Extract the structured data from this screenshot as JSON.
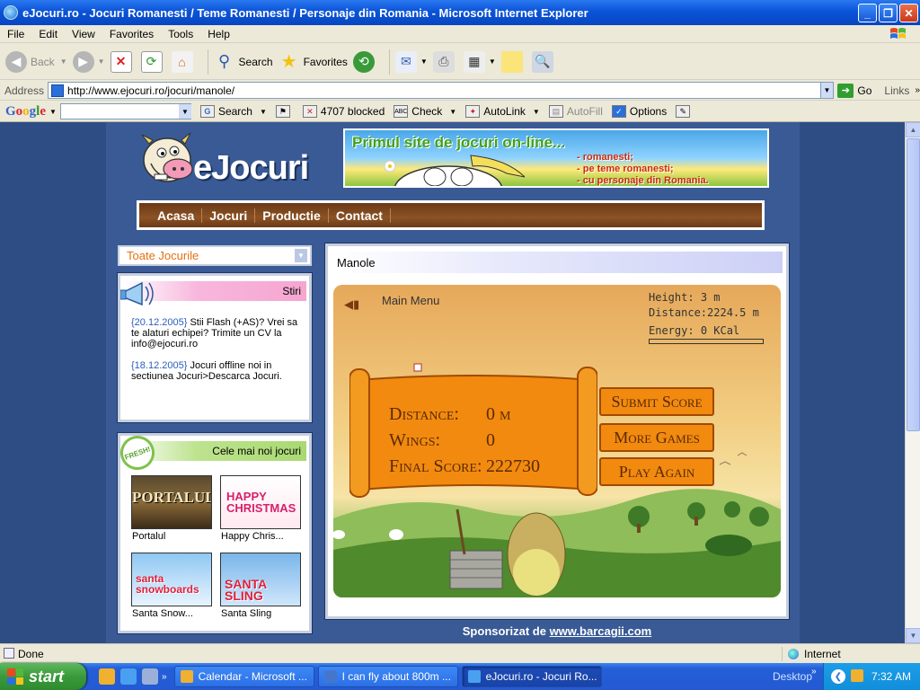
{
  "window": {
    "title": "eJocuri.ro - Jocuri Romanesti / Teme Romanesti / Personaje din Romania - Microsoft Internet Explorer"
  },
  "menu": [
    "File",
    "Edit",
    "View",
    "Favorites",
    "Tools",
    "Help"
  ],
  "toolbar": {
    "back": "Back",
    "search": "Search",
    "favorites": "Favorites"
  },
  "address": {
    "label": "Address",
    "url": "http://www.ejocuri.ro/jocuri/manole/",
    "go": "Go",
    "links": "Links"
  },
  "googlebar": {
    "logo": "Google",
    "search": "Search",
    "blocked": "4707 blocked",
    "check": "Check",
    "autolink": "AutoLink",
    "autofill": "AutoFill",
    "options": "Options"
  },
  "site": {
    "logo": "eJocuri",
    "banner": {
      "title": "Primul site de jocuri on-line...",
      "lines": [
        "- romanesti;",
        "- pe teme romanesti;",
        "- cu personaje din Romania."
      ]
    },
    "nav": [
      "Acasa",
      "Jocuri",
      "Productie",
      "Contact"
    ],
    "dropdown": "Toate Jocurile",
    "stiri": {
      "heading": "Stiri",
      "items": [
        {
          "date": "{20.12.2005}",
          "text": " Stii Flash (+AS)? Vrei sa te alaturi echipei? Trimite un CV la info@ejocuri.ro"
        },
        {
          "date": "{18.12.2005}",
          "text": " Jocuri offline noi in sectiunea Jocuri>Descarca Jocuri."
        }
      ]
    },
    "noi": {
      "heading": "Cele mai noi jocuri",
      "badge": "FRESH!",
      "games": [
        {
          "label": "Portalul",
          "art": "PORTALUL"
        },
        {
          "label": "Happy Chris...",
          "art": "HAPPY CHRISTMAS"
        },
        {
          "label": "Santa Snow...",
          "art": "santa snowboards"
        },
        {
          "label": "Santa Sling",
          "art": "SANTA SLING"
        }
      ]
    },
    "game": {
      "title": "Manole",
      "main_menu": "Main Menu",
      "height_label": "Height:",
      "height_value": "3 m",
      "distance_label": "Distance:",
      "distance_value": "2224.5 m",
      "energy_label": "Energy:",
      "energy_value": "0 KCal",
      "energy_fill": 0.0,
      "scroll": {
        "distance_label": "Distance:",
        "distance_value": "0 m",
        "wings_label": "Wings:",
        "wings_value": "0",
        "final_label": "Final Score:",
        "final_value": "222730"
      },
      "buttons": [
        "Submit Score",
        "More Games",
        "Play Again"
      ]
    },
    "sponsor_prefix": "Sponsorizat de ",
    "sponsor_link": "www.barcagii.com"
  },
  "status": {
    "text": "Done",
    "zone": "Internet"
  },
  "taskbar": {
    "start": "start",
    "tasks": [
      {
        "label": "Calendar - Microsoft ...",
        "color": "#f0b030"
      },
      {
        "label": "I can fly about 800m ...",
        "color": "#4477cc"
      },
      {
        "label": "eJocuri.ro - Jocuri Ro...",
        "color": "#4aa0f0",
        "active": true
      }
    ],
    "desktop": "Desktop",
    "clock": "7:32 AM"
  }
}
